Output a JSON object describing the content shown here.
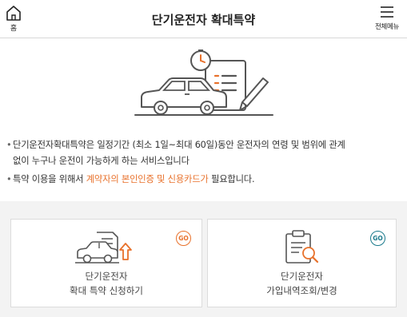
{
  "header": {
    "home_label": "홈",
    "title": "단기운전자 확대특약",
    "menu_label": "전체메뉴"
  },
  "description": {
    "line1": "단기운전자확대특약은 일정기간 (최소 1일~최대 60일)동안 운전자의 연령 및 범위에 관계",
    "line2": "없이 누구나 운전이 가능하게 하는 서비스입니다",
    "line3_prefix": "특약 이용을 위해서 ",
    "line3_highlight": "계약자의 본인인증 및 신용카드가",
    "line3_suffix": " 필요합니다."
  },
  "cards": [
    {
      "go": "GO",
      "title": "단기운전자",
      "subtitle": "확대 특약 신청하기",
      "icon": "car-document-upload-icon"
    },
    {
      "go": "GO",
      "title": "단기운전자",
      "subtitle": "가입내역조회/변경",
      "icon": "clipboard-search-icon"
    }
  ],
  "colors": {
    "accent": "#e8712b",
    "teal": "#1a7a8c",
    "text": "#333333",
    "background_gray": "#f3f3f3"
  }
}
